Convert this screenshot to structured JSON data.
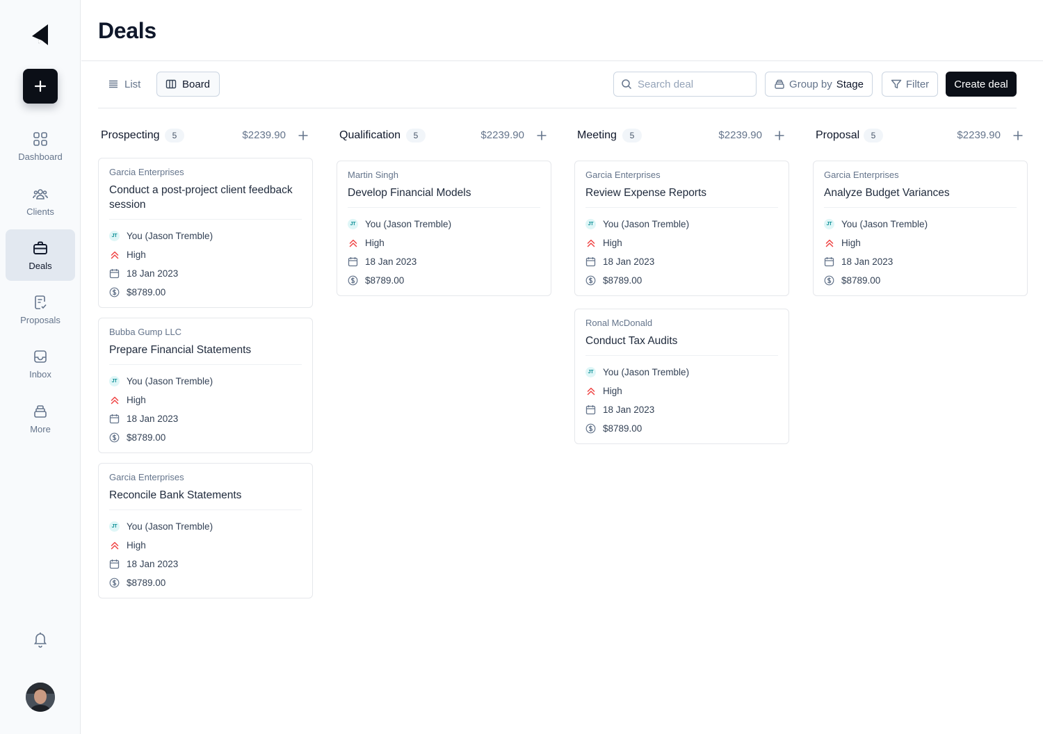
{
  "page": {
    "title": "Deals"
  },
  "sidebar": {
    "items": [
      {
        "label": "Dashboard",
        "icon": "grid-icon"
      },
      {
        "label": "Clients",
        "icon": "users-icon"
      },
      {
        "label": "Deals",
        "icon": "briefcase-icon"
      },
      {
        "label": "Proposals",
        "icon": "document-check-icon"
      },
      {
        "label": "Inbox",
        "icon": "inbox-icon"
      },
      {
        "label": "More",
        "icon": "stack-icon"
      }
    ],
    "active": "Deals"
  },
  "toolbar": {
    "list_label": "List",
    "board_label": "Board",
    "search_placeholder": "Search deal",
    "group_prefix": "Group by",
    "group_value": "Stage",
    "filter_label": "Filter",
    "create_label": "Create deal"
  },
  "columns": [
    {
      "name": "Prospecting",
      "count": "5",
      "total": "$2239.90",
      "cards": [
        {
          "company": "Garcia Enterprises",
          "title": "Conduct a post-project client feedback session",
          "owner_initials": "JT",
          "owner": "You (Jason Tremble)",
          "priority": "High",
          "date": "18 Jan 2023",
          "amount": "$8789.00"
        },
        {
          "company": "Bubba Gump LLC",
          "title": "Prepare Financial Statements",
          "owner_initials": "JT",
          "owner": "You (Jason Tremble)",
          "priority": "High",
          "date": "18 Jan 2023",
          "amount": "$8789.00"
        },
        {
          "company": "Garcia Enterprises",
          "title": "Reconcile Bank Statements",
          "owner_initials": "JT",
          "owner": "You (Jason Tremble)",
          "priority": "High",
          "date": "18 Jan 2023",
          "amount": "$8789.00"
        }
      ]
    },
    {
      "name": "Qualification",
      "count": "5",
      "total": "$2239.90",
      "cards": [
        {
          "company": "Martin Singh",
          "title": "Develop Financial Models",
          "owner_initials": "JT",
          "owner": "You (Jason Tremble)",
          "priority": "High",
          "date": "18 Jan 2023",
          "amount": "$8789.00"
        }
      ]
    },
    {
      "name": "Meeting",
      "count": "5",
      "total": "$2239.90",
      "cards": [
        {
          "company": "Garcia Enterprises",
          "title": "Review Expense Reports",
          "owner_initials": "JT",
          "owner": "You (Jason Tremble)",
          "priority": "High",
          "date": "18 Jan 2023",
          "amount": "$8789.00"
        },
        {
          "company": "Ronal McDonald",
          "title": "Conduct Tax Audits",
          "owner_initials": "JT",
          "owner": "You (Jason Tremble)",
          "priority": "High",
          "date": "18 Jan 2023",
          "amount": "$8789.00"
        }
      ]
    },
    {
      "name": "Proposal",
      "count": "5",
      "total": "$2239.90",
      "cards": [
        {
          "company": "Garcia Enterprises",
          "title": "Analyze Budget Variances",
          "owner_initials": "JT",
          "owner": "You (Jason Tremble)",
          "priority": "High",
          "date": "18 Jan 2023",
          "amount": "$8789.00"
        }
      ]
    }
  ],
  "colors": {
    "primary": "#0b0f17",
    "priority_high": "#ef4444",
    "avatar_bg": "#dff6f7",
    "avatar_text": "#0e8f96"
  }
}
